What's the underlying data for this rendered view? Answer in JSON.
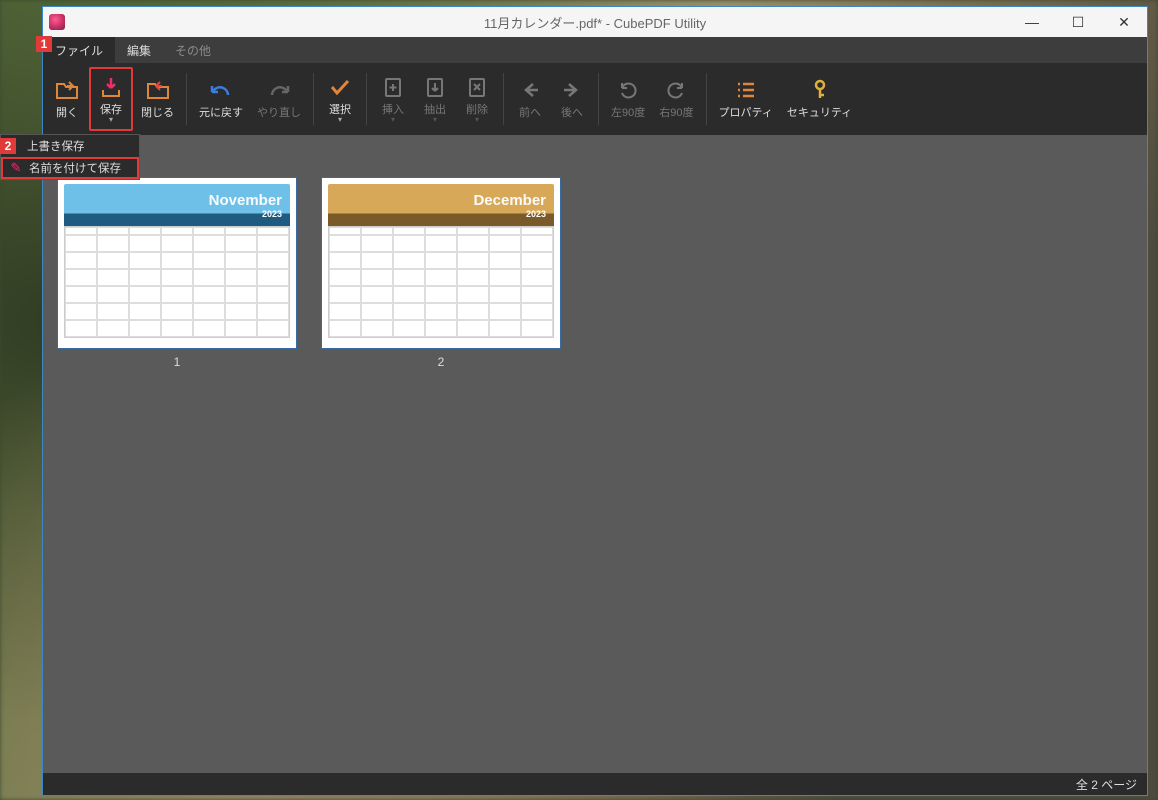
{
  "window": {
    "title": "11月カレンダー.pdf* - CubePDF Utility",
    "controls": {
      "min": "—",
      "max": "☐",
      "close": "✕"
    }
  },
  "menu": {
    "file": "ファイル",
    "edit": "編集",
    "other": "その他"
  },
  "ribbon": {
    "open": "開く",
    "save": "保存",
    "close": "閉じる",
    "undo": "元に戻す",
    "redo": "やり直し",
    "select": "選択",
    "insert": "挿入",
    "extract": "抽出",
    "delete": "削除",
    "prev": "前へ",
    "next": "後へ",
    "rot_l": "左90度",
    "rot_r": "右90度",
    "prop": "プロパティ",
    "sec": "セキュリティ"
  },
  "dropdown": {
    "overwrite": "上書き保存",
    "saveas": "名前を付けて保存"
  },
  "pages": {
    "p1": {
      "month": "November",
      "year": "2023",
      "num": "1"
    },
    "p2": {
      "month": "December",
      "year": "2023",
      "num": "2"
    }
  },
  "status": "全 2 ページ",
  "annot": {
    "a1": "1",
    "a2": "2"
  }
}
